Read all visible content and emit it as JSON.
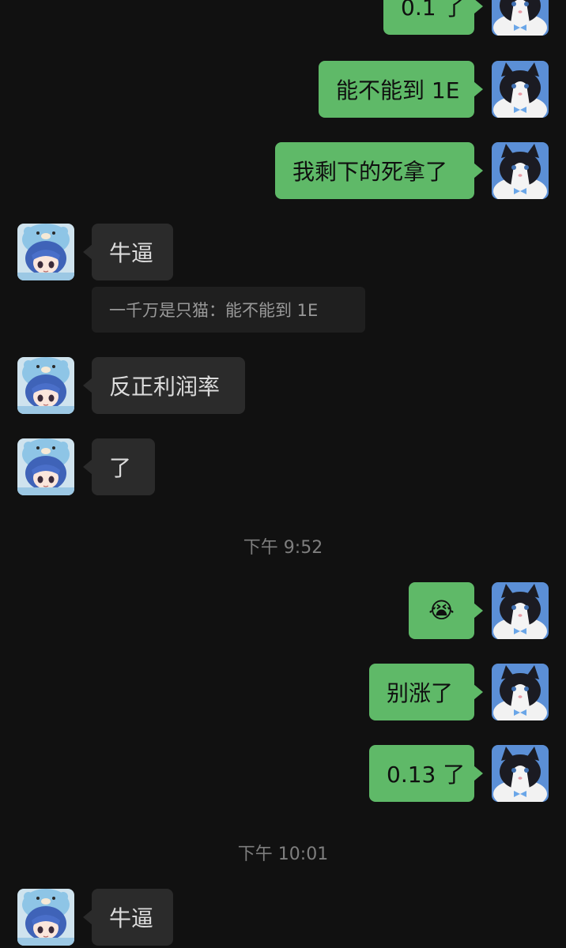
{
  "messages": {
    "m1": {
      "text": "0.1 了"
    },
    "m2": {
      "text": "能不能到 1E"
    },
    "m3": {
      "text": "我剩下的死拿了"
    },
    "m4": {
      "text": "牛逼"
    },
    "m4_quote": {
      "text": "一千万是只猫：能不能到 1E"
    },
    "m5": {
      "text": "反正利润率"
    },
    "m6": {
      "text": "了"
    },
    "m7": {
      "text": "😭"
    },
    "m8": {
      "text": "别涨了"
    },
    "m9": {
      "text": "0.13 了"
    },
    "m10": {
      "text": "牛逼"
    }
  },
  "timestamps": {
    "t1": "下午 9:52",
    "t2": "下午 10:01"
  },
  "colors": {
    "background": "#111111",
    "sent_bubble": "#5fb968",
    "received_bubble": "#2b2b2b"
  }
}
